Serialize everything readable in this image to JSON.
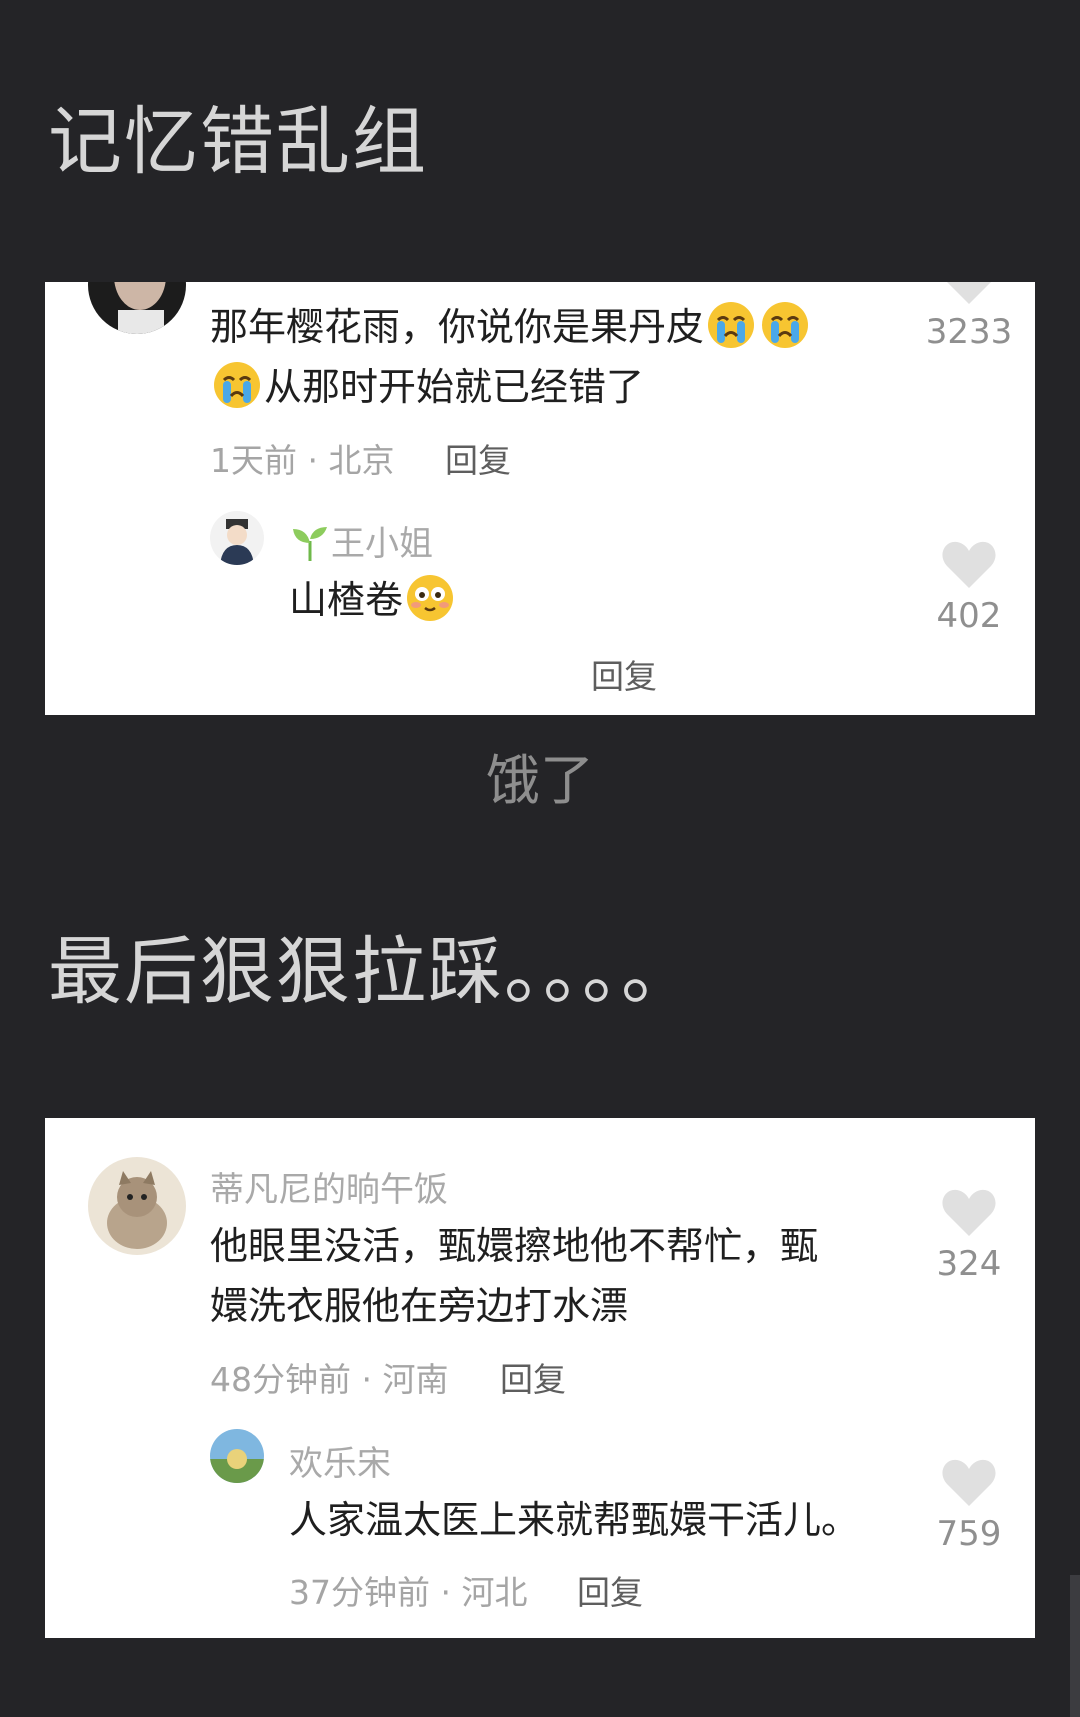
{
  "headings": {
    "first": "记忆错乱组",
    "second": "最后狠狠拉踩。。。。"
  },
  "caption": "饿了",
  "card1": {
    "comment": {
      "text_line1": "那年樱花雨，你说你是果丹皮",
      "text_line2": "从那时开始就已经错了",
      "meta": "1天前 · 北京",
      "reply_label": "回复",
      "likes": "3233"
    },
    "reply": {
      "username": "王小姐",
      "text": "山楂卷",
      "reply_label": "回复",
      "likes": "402"
    }
  },
  "card2": {
    "comment": {
      "username": "蒂凡尼的晌午饭",
      "text_line1": "他眼里没活，甄嬛擦地他不帮忙，甄",
      "text_line2": "嬛洗衣服他在旁边打水漂",
      "meta": "48分钟前 · 河南",
      "reply_label": "回复",
      "likes": "324"
    },
    "reply": {
      "username": "欢乐宋",
      "text": "人家温太医上来就帮甄嬛干活儿。",
      "meta": "37分钟前 · 河北",
      "reply_label": "回复",
      "likes": "759"
    }
  },
  "icons": {
    "like": "heart-icon",
    "crying": "crying-emoji-icon",
    "smiling": "blushing-emoji-icon",
    "sprout": "sprout-icon"
  },
  "colors": {
    "background": "#242427",
    "card": "#ffffff",
    "heart": "#e0e0e0"
  }
}
